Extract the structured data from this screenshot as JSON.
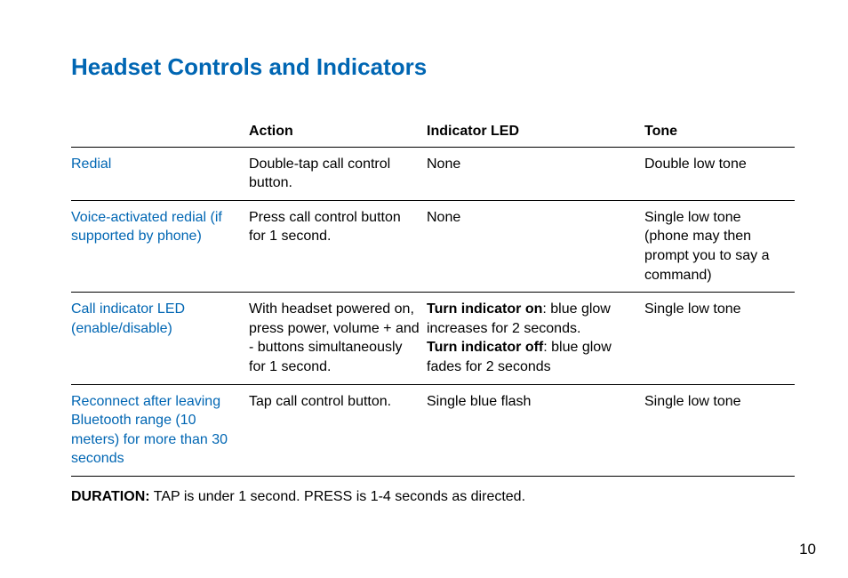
{
  "title": "Headset Controls and Indicators",
  "headers": {
    "func": "",
    "action": "Action",
    "led": "Indicator LED",
    "tone": "Tone"
  },
  "rows": [
    {
      "func": "Redial",
      "action": "Double-tap call control button.",
      "led": "None",
      "tone": "Double low tone"
    },
    {
      "func": "Voice-activated redial (if supported by phone)",
      "action": "Press call control button for 1 second.",
      "led": "None",
      "tone": "Single low tone (phone may then prompt you to say a command)"
    },
    {
      "func": "Call indicator LED (enable/disable)",
      "action": "With headset powered on, press power, volume + and - buttons simultaneously for 1 second.",
      "led_on_label": "Turn indicator on",
      "led_on_text": ": blue glow increases for 2 seconds.",
      "led_off_label": "Turn indicator off",
      "led_off_text": ": blue glow fades for 2 seconds",
      "tone": "Single low tone"
    },
    {
      "func": "Reconnect after leaving Bluetooth range (10 meters) for more than 30 seconds",
      "action": "Tap call control button.",
      "led": "Single blue flash",
      "tone": "Single low tone"
    }
  ],
  "duration_label": "DURATION:",
  "duration_text": " TAP is under 1 second. PRESS is 1-4 seconds as directed.",
  "page_number": "10"
}
